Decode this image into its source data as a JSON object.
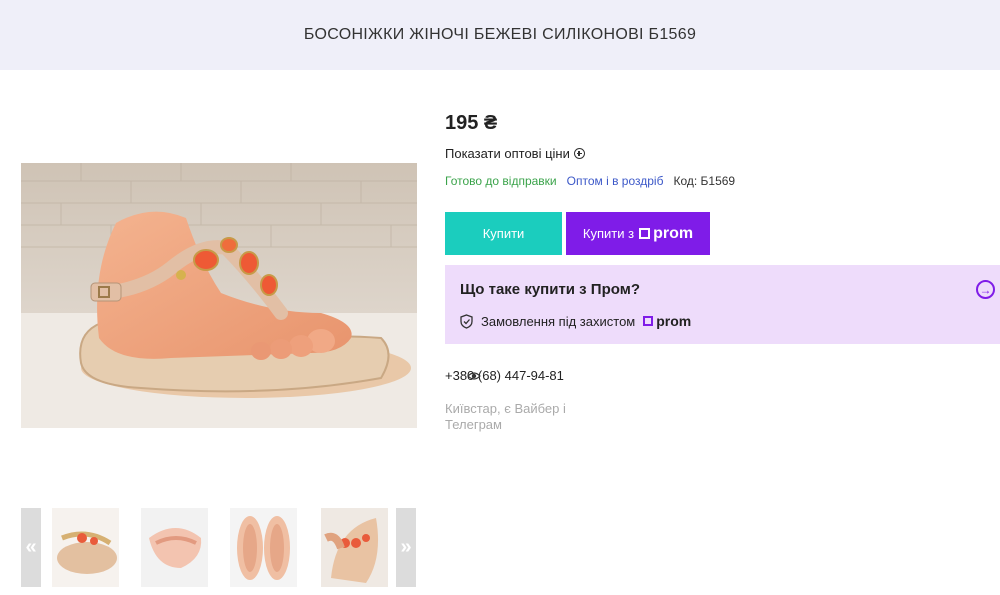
{
  "header": {
    "title": "БОСОНІЖКИ ЖІНОЧІ БЕЖЕВІ СИЛІКОНОВІ Б1569"
  },
  "product": {
    "price": "195 ₴",
    "wholesale_link": "Показати оптові ціни",
    "status_ready": "Готово до відправки",
    "status_retail": "Оптом і в роздріб",
    "code": "Код: Б1569"
  },
  "buttons": {
    "buy_label": "Купити",
    "buy_prom_label": "Купити з",
    "prom_logo_text": "prom"
  },
  "prom_info": {
    "title": "Що таке купити з Пром?",
    "protection_text": "Замовлення під захистом",
    "logo_text": "prom"
  },
  "contact": {
    "phone": "+380 (68) 447-94-81",
    "note": "Київстар, є Вайбер і Телеграм"
  },
  "gallery": {
    "prev_label": "«",
    "next_label": "»"
  },
  "colors": {
    "header_bg": "#efeff9",
    "buy_button": "#1bcdbe",
    "prom_button": "#7f1ce8",
    "prom_box_bg": "#eedcfb",
    "status_green": "#3aa34a",
    "status_blue": "#3c58c8"
  },
  "icons": [
    "plus-circle-icon",
    "prom-logo-icon",
    "arrow-right-circle-icon",
    "shield-check-icon",
    "eye-icon"
  ]
}
